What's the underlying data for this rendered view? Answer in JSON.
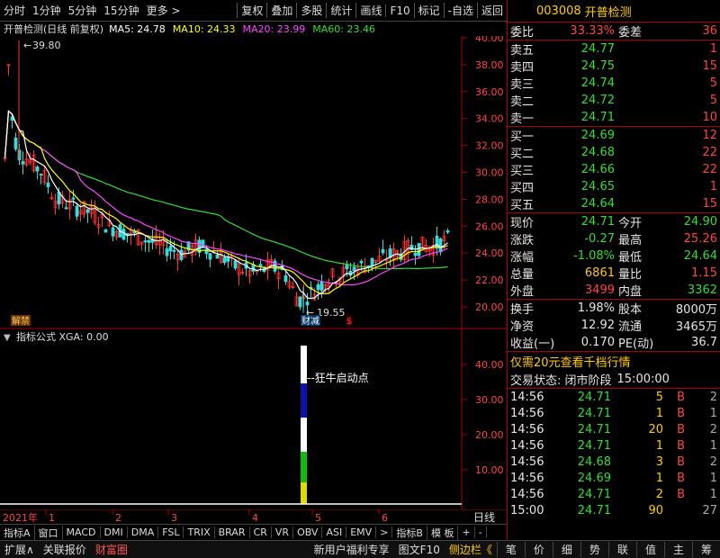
{
  "toolbar": {
    "left_items": [
      "分时",
      "1分钟",
      "5分钟",
      "15分钟",
      "更多 >"
    ],
    "right_items": [
      "复权",
      "叠加",
      "多股",
      "统计",
      "画线",
      "F10",
      "标记",
      "-自选",
      "返回"
    ]
  },
  "chart": {
    "title": "开普检测(日线 前复权)",
    "ma": [
      {
        "label": "MA5: 24.78",
        "color": "#ffffff"
      },
      {
        "label": "MA10: 24.33",
        "color": "#ffff00"
      },
      {
        "label": "MA20: 23.99",
        "color": "#ff44ff"
      },
      {
        "label": "MA60: 23.46",
        "color": "#33dd33"
      }
    ],
    "high_label": "39.80",
    "low_label": "19.55",
    "event_labels": [
      "解禁",
      "财减"
    ],
    "y_axis": [
      "40.00",
      "38.00",
      "36.00",
      "34.00",
      "32.00",
      "30.00",
      "28.00",
      "26.00",
      "24.00",
      "22.00",
      "20.00"
    ]
  },
  "indicator": {
    "title": "指标公式  XGA: 0.00",
    "annotation": "--狂牛启动点",
    "y_axis": [
      "40.00",
      "30.00",
      "20.00",
      "10.00"
    ]
  },
  "x_axis": {
    "year": "2021年",
    "months": [
      "1",
      "2",
      "3",
      "4",
      "5",
      "6"
    ],
    "right_label": "日线"
  },
  "bottom_tabs": [
    "指标A",
    "窗口",
    "MACD",
    "DMI",
    "DMA",
    "FSL",
    "TRIX",
    "BRAR",
    "CR",
    "VR",
    "OBV",
    "ASI",
    "EMV",
    ">",
    "指标B",
    "模 板",
    "+",
    "-"
  ],
  "status_left": [
    "扩展∧",
    "关联报价",
    "财富圈"
  ],
  "status_mid": [
    "新用户福利专享",
    "图文F10",
    "侧边栏《"
  ],
  "status_right": [
    "笔",
    "价",
    "细",
    "势",
    "联",
    "值",
    "主",
    "筹"
  ],
  "quote": {
    "code": "003008",
    "name": "开普检测",
    "weibi_label": "委比",
    "weibi": "33.33%",
    "weicha_label": "委差",
    "weicha": "36",
    "sells": [
      {
        "label": "卖五",
        "price": "24.77",
        "vol": "1"
      },
      {
        "label": "卖四",
        "price": "24.75",
        "vol": "15"
      },
      {
        "label": "卖三",
        "price": "24.74",
        "vol": "5"
      },
      {
        "label": "卖二",
        "price": "24.72",
        "vol": "5"
      },
      {
        "label": "卖一",
        "price": "24.71",
        "vol": "10"
      }
    ],
    "buys": [
      {
        "label": "买一",
        "price": "24.69",
        "vol": "12"
      },
      {
        "label": "买二",
        "price": "24.68",
        "vol": "22"
      },
      {
        "label": "买三",
        "price": "24.66",
        "vol": "22"
      },
      {
        "label": "买四",
        "price": "24.65",
        "vol": "1"
      },
      {
        "label": "买五",
        "price": "24.64",
        "vol": "15"
      }
    ],
    "stats": [
      {
        "l1": "现价",
        "v1": "24.71",
        "c1": "grn",
        "l2": "今开",
        "v2": "24.90",
        "c2": "grn"
      },
      {
        "l1": "涨跌",
        "v1": "-0.27",
        "c1": "grn",
        "l2": "最高",
        "v2": "25.26",
        "c2": "red"
      },
      {
        "l1": "涨幅",
        "v1": "-1.08%",
        "c1": "grn",
        "l2": "最低",
        "v2": "24.64",
        "c2": "grn"
      },
      {
        "l1": "总量",
        "v1": "6861",
        "c1": "yel",
        "l2": "量比",
        "v2": "1.15",
        "c2": "red"
      },
      {
        "l1": "外盘",
        "v1": "3499",
        "c1": "red",
        "l2": "内盘",
        "v2": "3362",
        "c2": "grn"
      }
    ],
    "stats2": [
      {
        "l1": "换手",
        "v1": "1.98%",
        "l2": "股本",
        "v2": "8000万"
      },
      {
        "l1": "净资",
        "v1": "12.92",
        "l2": "流通",
        "v2": "3465万"
      },
      {
        "l1": "收益(一)",
        "v1": "0.170",
        "l2": "PE(动)",
        "v2": "36.7"
      }
    ],
    "promo": "仅需20元查看千档行情",
    "trade_status_label": "交易状态: 闭市阶段",
    "trade_status_time": "15:00:00",
    "ticks": [
      {
        "t": "14:56",
        "p": "24.71",
        "v": "5",
        "d": "B",
        "n": "2"
      },
      {
        "t": "14:56",
        "p": "24.71",
        "v": "1",
        "d": "B",
        "n": "1"
      },
      {
        "t": "14:56",
        "p": "24.71",
        "v": "20",
        "d": "B",
        "n": "2"
      },
      {
        "t": "14:56",
        "p": "24.71",
        "v": "1",
        "d": "B",
        "n": "1"
      },
      {
        "t": "14:56",
        "p": "24.68",
        "v": "3",
        "d": "B",
        "n": "2"
      },
      {
        "t": "14:56",
        "p": "24.69",
        "v": "1",
        "d": "B",
        "n": "1"
      },
      {
        "t": "14:56",
        "p": "24.71",
        "v": "2",
        "d": "B",
        "n": "1"
      },
      {
        "t": "15:00",
        "p": "24.71",
        "v": "90",
        "d": "",
        "n": "27"
      }
    ]
  }
}
